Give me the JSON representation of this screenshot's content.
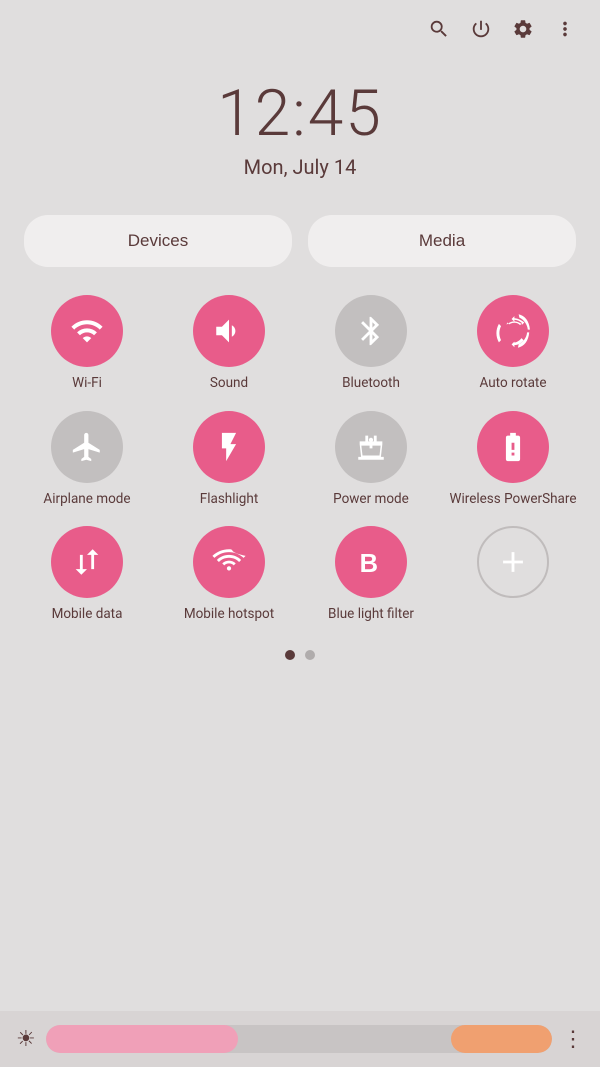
{
  "topBar": {
    "icons": [
      "search",
      "power",
      "settings",
      "more"
    ]
  },
  "clock": {
    "time": "12:45",
    "date": "Mon, July 14"
  },
  "deviceMedia": {
    "devices_label": "Devices",
    "media_label": "Media"
  },
  "toggles": [
    {
      "id": "wifi",
      "label": "Wi-Fi",
      "active": true,
      "icon": "wifi"
    },
    {
      "id": "sound",
      "label": "Sound",
      "active": true,
      "icon": "sound"
    },
    {
      "id": "bluetooth",
      "label": "Bluetooth",
      "active": false,
      "icon": "bluetooth"
    },
    {
      "id": "autorotate",
      "label": "Auto\nrotate",
      "active": true,
      "icon": "autorotate"
    },
    {
      "id": "airplane",
      "label": "Airplane\nmode",
      "active": false,
      "icon": "airplane"
    },
    {
      "id": "flashlight",
      "label": "Flashlight",
      "active": true,
      "icon": "flashlight"
    },
    {
      "id": "powermode",
      "label": "Power\nmode",
      "active": false,
      "icon": "powermode"
    },
    {
      "id": "wireless",
      "label": "Wireless\nPowerShare",
      "active": true,
      "icon": "wireless"
    },
    {
      "id": "mobiledata",
      "label": "Mobile\ndata",
      "active": true,
      "icon": "mobiledata"
    },
    {
      "id": "hotspot",
      "label": "Mobile\nhotspot",
      "active": true,
      "icon": "hotspot"
    },
    {
      "id": "bluelight",
      "label": "Blue light\nfilter",
      "active": true,
      "icon": "bluelight"
    },
    {
      "id": "add",
      "label": "",
      "active": false,
      "icon": "add"
    }
  ],
  "pageDots": [
    {
      "active": true
    },
    {
      "active": false
    }
  ],
  "brightness": {
    "icon": "☀",
    "more_icon": "⋮"
  }
}
